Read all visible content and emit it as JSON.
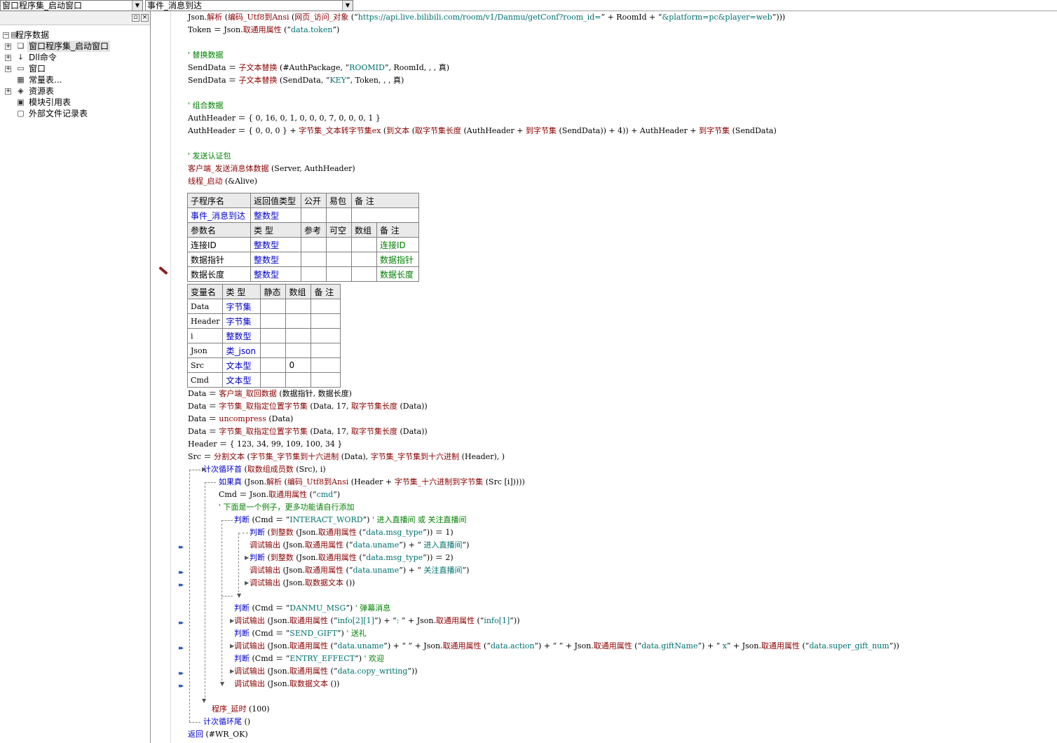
{
  "topbar": {
    "class_select": "窗口程序集_启动窗口",
    "sub_select": "事件_消息到达"
  },
  "left_panel": {
    "tree": [
      {
        "label": "程序数据",
        "icon": "folder-icon",
        "expanded": true
      },
      {
        "label": "窗口程序集_启动窗口",
        "icon": "program-set-icon",
        "selected": true
      },
      {
        "label": "Dll命令",
        "icon": "dll-icon"
      },
      {
        "label": "窗口",
        "icon": "window-icon"
      },
      {
        "label": "常量表...",
        "icon": "constant-table-icon"
      },
      {
        "label": "资源表",
        "icon": "resource-icon"
      },
      {
        "label": "模块引用表",
        "icon": "module-icon"
      },
      {
        "label": "外部文件记录表",
        "icon": "file-icon"
      }
    ]
  },
  "code_top": {
    "l1": [
      "Json",
      ".",
      "解析",
      " (",
      "编码_Utf8到Ansi",
      " (",
      "网页_访问_对象",
      " (“",
      "https://api.live.bilibili.com/room/v1/Danmu/getConf?room_id=",
      "” + RoomId + “",
      "&platform=pc&player=web",
      "”)))"
    ],
    "l2": [
      "Token ＝ Json.",
      "取通用属性",
      " (“",
      "data.token",
      "”)"
    ],
    "c_replace": "' 替换数据",
    "l3": [
      "SendData ＝ ",
      "子文本替换",
      " (#AuthPackage, “",
      "ROOMID",
      "”, RoomId, , , 真)"
    ],
    "l4": [
      "SendData ＝ ",
      "子文本替换",
      " (SendData, “",
      "KEY",
      "”, Token, , , 真)"
    ],
    "c_combine": "' 组合数据",
    "l5": "AuthHeader ＝ { 0, 16, 0, 1, 0, 0, 0, 7, 0, 0, 0, 1 }",
    "l6": [
      "AuthHeader ＝ { 0, 0, 0 } + ",
      "字节集_文本转字节集ex",
      " (",
      "到文本",
      " (",
      "取字节集长度",
      " (AuthHeader + ",
      "到字节集",
      " (SendData)) + 4)) + AuthHeader + ",
      "到字节集",
      " (SendData)"
    ],
    "c_send": "' 发送认证包",
    "l7": [
      "客户端_发送消息体数据",
      " (Server, AuthHeader)"
    ],
    "l8": [
      "线程_启动",
      " (&Alive)"
    ]
  },
  "sub_table": {
    "header": [
      "子程序名",
      "返回值类型",
      "公开",
      "易包",
      "备 注"
    ],
    "row": [
      "事件_消息到达",
      "整数型",
      "",
      "",
      ""
    ],
    "param_header": [
      "参数名",
      "类 型",
      "参考",
      "可空",
      "数组",
      "备 注"
    ],
    "params": [
      [
        "连接ID",
        "整数型",
        "",
        "",
        "",
        "连接ID"
      ],
      [
        "数据指针",
        "整数型",
        "",
        "",
        "",
        "数据指针"
      ],
      [
        "数据长度",
        "整数型",
        "",
        "",
        "",
        "数据长度"
      ]
    ]
  },
  "var_table": {
    "header": [
      "变量名",
      "类 型",
      "静态",
      "数组",
      "备 注"
    ],
    "rows": [
      [
        "Data",
        "字节集",
        "",
        "",
        ""
      ],
      [
        "Header",
        "字节集",
        "",
        "",
        ""
      ],
      [
        "i",
        "整数型",
        "",
        "",
        ""
      ],
      [
        "Json",
        "类_json",
        "",
        "",
        ""
      ],
      [
        "Src",
        "文本型",
        "",
        "0",
        ""
      ],
      [
        "Cmd",
        "文本型",
        "",
        "",
        ""
      ]
    ]
  },
  "code_body": {
    "b1": [
      "Data ＝ ",
      "客户端_取回数据",
      " (数据指针, 数据长度)"
    ],
    "b2": [
      "Data ＝ ",
      "字节集_取指定位置字节集",
      " (Data, 17, ",
      "取字节集长度",
      " (Data))"
    ],
    "b3": [
      "Data ＝ ",
      "uncompress",
      " (Data)"
    ],
    "b4": [
      "Data ＝ ",
      "字节集_取指定位置字节集",
      " (Data, 17, ",
      "取字节集长度",
      " (Data))"
    ],
    "b5": "Header ＝ { 123, 34, 99, 109, 100, 34 }",
    "b6": [
      "Src ＝ ",
      "分割文本",
      " (",
      "字节集_字节集到十六进制",
      " (Data), ",
      "字节集_字节集到十六进制",
      " (Header), )"
    ],
    "b7": [
      "计次循环首",
      " (",
      "取数组成员数",
      " (Src), i)"
    ],
    "b8": [
      "如果真",
      " (Json.",
      "解析",
      " (",
      "编码_Utf8到Ansi",
      " (Header + ",
      "字节集_十六进制到字节集",
      " (Src [i]))))"
    ],
    "b9": [
      "Cmd ＝ Json.",
      "取通用属性",
      " (“",
      "cmd",
      "”)"
    ],
    "c_example": "' 下面是一个例子，更多功能请自行添加",
    "b10": [
      "判断",
      " (Cmd ＝ “",
      "INTERACT_WORD",
      "”) ",
      "' 进入直播间 或 关注直播间"
    ],
    "b11": [
      "判断",
      " (",
      "到整数",
      " (Json.",
      "取通用属性",
      " (“",
      "data.msg_type",
      "”)) ＝ 1)"
    ],
    "b12": [
      "调试输出",
      " (Json.",
      "取通用属性",
      " (“",
      "data.uname",
      "”) + “ ",
      "进入直播间",
      "”)"
    ],
    "b13": [
      "判断",
      " (",
      "到整数",
      " (Json.",
      "取通用属性",
      " (“",
      "data.msg_type",
      "”)) ＝ 2)"
    ],
    "b14": [
      "调试输出",
      " (Json.",
      "取通用属性",
      " (“",
      "data.uname",
      "”) + “ ",
      "关注直播间",
      "”)"
    ],
    "b15": [
      "调试输出",
      " (Json.",
      "取数据文本",
      " ())"
    ],
    "b16": [
      "判断",
      " (Cmd ＝ “",
      "DANMU_MSG",
      "”) ",
      "' 弹幕消息"
    ],
    "b17": [
      "调试输出",
      " (Json.",
      "取通用属性",
      " (“",
      "info[2][1]",
      "”) + “",
      ": ",
      "” + Json.",
      "取通用属性",
      " (“",
      "info[1]",
      "”))"
    ],
    "b18": [
      "判断",
      " (Cmd ＝ “",
      "SEND_GIFT",
      "”) ",
      "' 送礼"
    ],
    "b19": [
      "调试输出",
      " (Json.",
      "取通用属性",
      " (“",
      "data.uname",
      "”) + “ ”  + Json.",
      "取通用属性",
      " (“",
      "data.action",
      "”) + “ ” + Json.",
      "取通用属性",
      " (“",
      "data.giftName",
      "”) + “ ",
      "x",
      "” + Json.",
      "取通用属性",
      " (“",
      "data.super_gift_num",
      "”))"
    ],
    "b20": [
      "判断",
      " (Cmd ＝ “",
      "ENTRY_EFFECT",
      "”) ",
      "' 欢迎"
    ],
    "b21": [
      "调试输出",
      " (Json.",
      "取通用属性",
      " (“",
      "data.copy_writing",
      "”))"
    ],
    "b22": [
      "调试输出",
      " (Json.",
      "取数据文本",
      " ())"
    ],
    "b23": [
      "程序_延时",
      " (100)"
    ],
    "b24": [
      "计次循环尾",
      " ()"
    ],
    "b25": [
      "返回",
      " (#WR_OK)"
    ]
  }
}
